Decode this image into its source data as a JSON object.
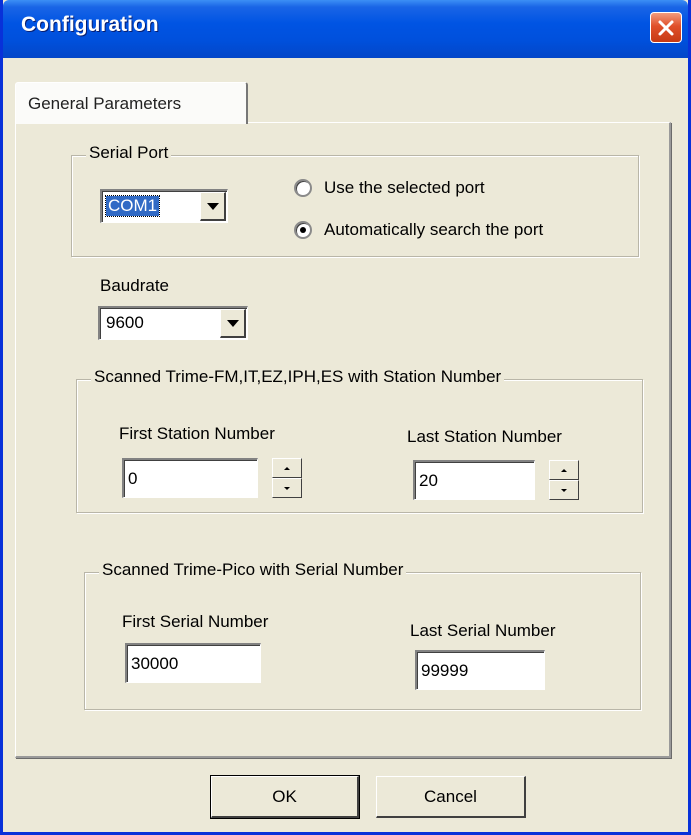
{
  "window": {
    "title": "Configuration"
  },
  "tabs": [
    {
      "label": "General Parameters"
    }
  ],
  "serial_port": {
    "group_label": "Serial Port",
    "port_value": "COM1",
    "radio_options": [
      {
        "label": "Use the selected port",
        "checked": false
      },
      {
        "label": "Automatically search the port",
        "checked": true
      }
    ]
  },
  "baudrate": {
    "label": "Baudrate",
    "value": "9600"
  },
  "station_group": {
    "group_label": "Scanned Trime-FM,IT,EZ,IPH,ES with Station Number",
    "first_label": "First Station Number",
    "first_value": "0",
    "last_label": "Last Station Number",
    "last_value": "20"
  },
  "serial_group": {
    "group_label": "Scanned Trime-Pico with Serial Number",
    "first_label": "First Serial Number",
    "first_value": "30000",
    "last_label": "Last Serial Number",
    "last_value": "99999"
  },
  "buttons": {
    "ok": "OK",
    "cancel": "Cancel"
  },
  "colors": {
    "title_bar": "#0054e3",
    "dialog_bg": "#ece9d8",
    "close_button": "#e0502a",
    "selection": "#316ac5"
  }
}
